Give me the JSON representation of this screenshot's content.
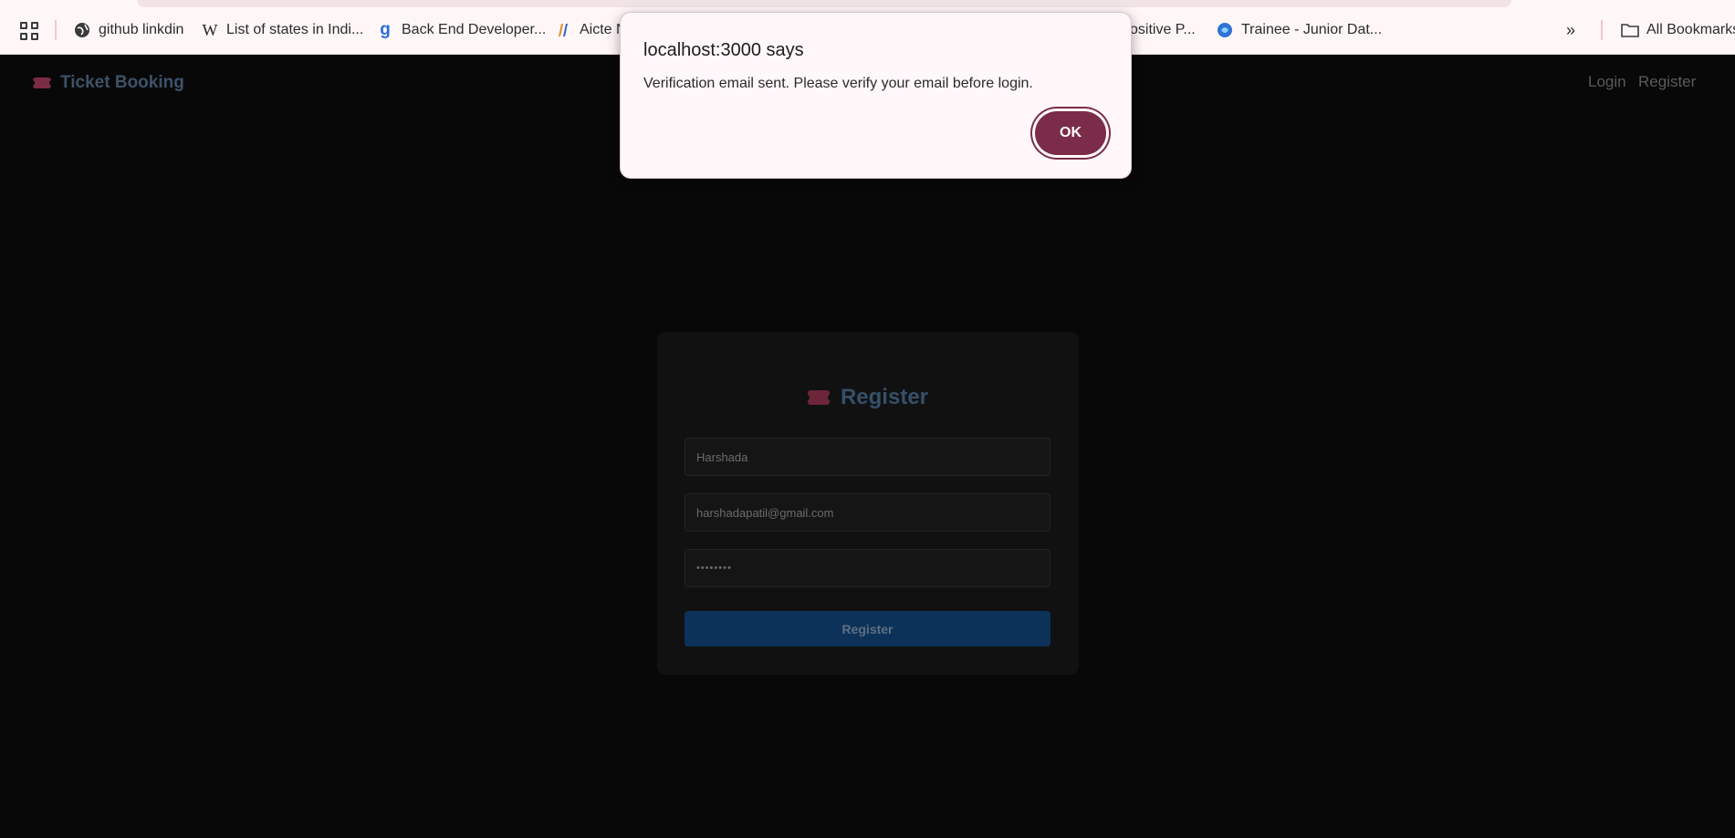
{
  "bookmarks": {
    "items": [
      {
        "label": "github linkdin",
        "icon": "globe-icon"
      },
      {
        "label": "List of states in Indi...",
        "icon": "wikipedia-icon"
      },
      {
        "label": "Back End Developer...",
        "icon": "glassdoor-icon"
      },
      {
        "label": "Aicte N",
        "icon": "aicte-icon"
      },
      {
        "label": "ositive P...",
        "icon": "bookmark-icon"
      },
      {
        "label": "Trainee - Junior Dat...",
        "icon": "bookmark-icon"
      }
    ],
    "overflow_icon": "double-chevron-right-icon",
    "all_bookmarks_label": "All Bookmarks"
  },
  "navbar": {
    "brand": "Ticket Booking",
    "login": "Login",
    "register": "Register"
  },
  "form": {
    "title": "Register",
    "name_value": "Harshada",
    "email_value": "harshadapatil@gmail.com",
    "password_value": "••••••••",
    "submit_label": "Register"
  },
  "dialog": {
    "title": "localhost:3000 says",
    "message": "Verification email sent. Please verify your email before login.",
    "ok_label": "OK"
  },
  "colors": {
    "accent": "#7b2c48",
    "primary_button": "#0d3259",
    "brand_text": "#3d5268"
  }
}
